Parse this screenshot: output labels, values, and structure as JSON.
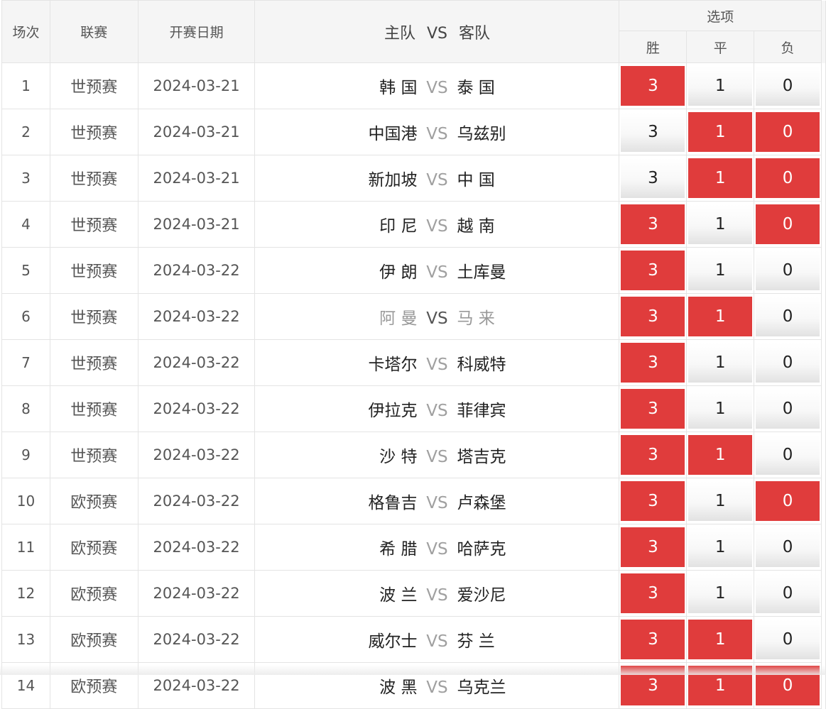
{
  "header": {
    "match_no": "场次",
    "league": "联赛",
    "date": "开赛日期",
    "home": "主队",
    "vs": "VS",
    "away": "客队",
    "options": "选项",
    "win": "胜",
    "draw": "平",
    "loss": "负"
  },
  "colors": {
    "selected": "#e03c3c",
    "header_bg": "#f5f5f5",
    "border": "#e4e4e4"
  },
  "matches": [
    {
      "no": "1",
      "league": "世预赛",
      "date": "2024-03-21",
      "home": "韩 国",
      "vs": "VS",
      "away": "泰 国",
      "win": "3",
      "draw": "1",
      "loss": "0",
      "sel": [
        true,
        false,
        false
      ],
      "muted": false
    },
    {
      "no": "2",
      "league": "世预赛",
      "date": "2024-03-21",
      "home": "中国港",
      "vs": "VS",
      "away": "乌兹别",
      "win": "3",
      "draw": "1",
      "loss": "0",
      "sel": [
        false,
        true,
        true
      ],
      "muted": false
    },
    {
      "no": "3",
      "league": "世预赛",
      "date": "2024-03-21",
      "home": "新加坡",
      "vs": "VS",
      "away": "中 国",
      "win": "3",
      "draw": "1",
      "loss": "0",
      "sel": [
        false,
        true,
        true
      ],
      "muted": false
    },
    {
      "no": "4",
      "league": "世预赛",
      "date": "2024-03-21",
      "home": "印 尼",
      "vs": "VS",
      "away": "越 南",
      "win": "3",
      "draw": "1",
      "loss": "0",
      "sel": [
        true,
        false,
        true
      ],
      "muted": false
    },
    {
      "no": "5",
      "league": "世预赛",
      "date": "2024-03-22",
      "home": "伊 朗",
      "vs": "VS",
      "away": "土库曼",
      "win": "3",
      "draw": "1",
      "loss": "0",
      "sel": [
        true,
        false,
        false
      ],
      "muted": false
    },
    {
      "no": "6",
      "league": "世预赛",
      "date": "2024-03-22",
      "home": "阿 曼",
      "vs": "VS",
      "away": "马 来",
      "win": "3",
      "draw": "1",
      "loss": "0",
      "sel": [
        true,
        true,
        false
      ],
      "muted": true
    },
    {
      "no": "7",
      "league": "世预赛",
      "date": "2024-03-22",
      "home": "卡塔尔",
      "vs": "VS",
      "away": "科威特",
      "win": "3",
      "draw": "1",
      "loss": "0",
      "sel": [
        true,
        false,
        false
      ],
      "muted": false
    },
    {
      "no": "8",
      "league": "世预赛",
      "date": "2024-03-22",
      "home": "伊拉克",
      "vs": "VS",
      "away": "菲律宾",
      "win": "3",
      "draw": "1",
      "loss": "0",
      "sel": [
        true,
        false,
        false
      ],
      "muted": false
    },
    {
      "no": "9",
      "league": "世预赛",
      "date": "2024-03-22",
      "home": "沙 特",
      "vs": "VS",
      "away": "塔吉克",
      "win": "3",
      "draw": "1",
      "loss": "0",
      "sel": [
        true,
        true,
        false
      ],
      "muted": false
    },
    {
      "no": "10",
      "league": "欧预赛",
      "date": "2024-03-22",
      "home": "格鲁吉",
      "vs": "VS",
      "away": "卢森堡",
      "win": "3",
      "draw": "1",
      "loss": "0",
      "sel": [
        true,
        false,
        true
      ],
      "muted": false
    },
    {
      "no": "11",
      "league": "欧预赛",
      "date": "2024-03-22",
      "home": "希 腊",
      "vs": "VS",
      "away": "哈萨克",
      "win": "3",
      "draw": "1",
      "loss": "0",
      "sel": [
        true,
        false,
        false
      ],
      "muted": false
    },
    {
      "no": "12",
      "league": "欧预赛",
      "date": "2024-03-22",
      "home": "波 兰",
      "vs": "VS",
      "away": "爱沙尼",
      "win": "3",
      "draw": "1",
      "loss": "0",
      "sel": [
        true,
        false,
        false
      ],
      "muted": false
    },
    {
      "no": "13",
      "league": "欧预赛",
      "date": "2024-03-22",
      "home": "威尔士",
      "vs": "VS",
      "away": "芬 兰",
      "win": "3",
      "draw": "1",
      "loss": "0",
      "sel": [
        true,
        true,
        false
      ],
      "muted": false
    },
    {
      "no": "14",
      "league": "欧预赛",
      "date": "2024-03-22",
      "home": "波 黑",
      "vs": "VS",
      "away": "乌克兰",
      "win": "3",
      "draw": "1",
      "loss": "0",
      "sel": [
        true,
        true,
        true
      ],
      "muted": false
    }
  ]
}
